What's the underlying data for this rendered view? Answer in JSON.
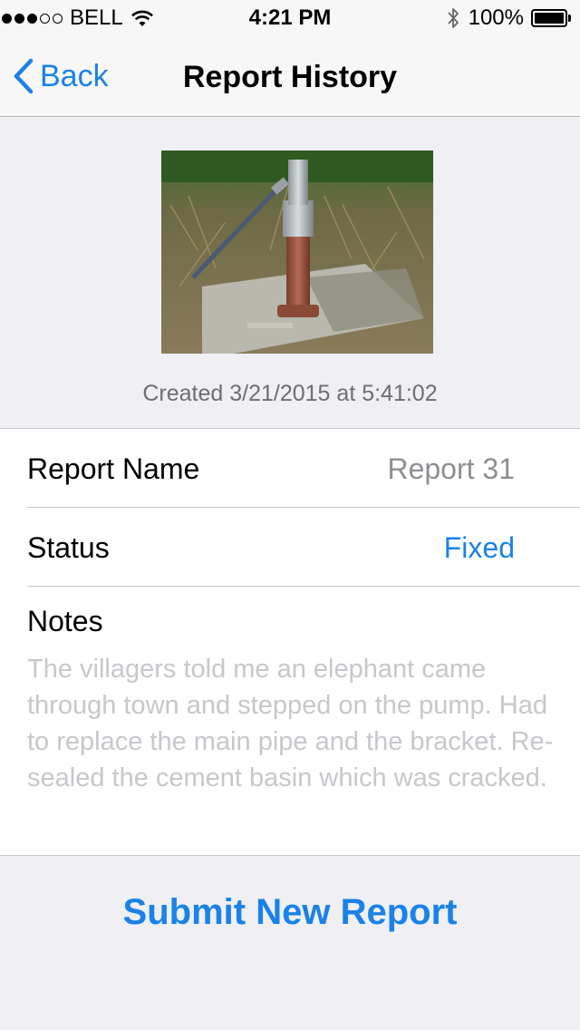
{
  "status_bar": {
    "carrier": "BELL",
    "time": "4:21 PM",
    "battery": "100%",
    "signal_bars": 3,
    "signal_total": 5
  },
  "nav": {
    "back_label": "Back",
    "title": "Report History"
  },
  "report": {
    "created": "Created 3/21/2015 at 5:41:02",
    "name_label": "Report Name",
    "name_value": "Report 31",
    "status_label": "Status",
    "status_value": "Fixed",
    "notes_label": "Notes",
    "notes_text": "The villagers told me an elephant came through town and stepped on the pump. Had to replace the main pipe and the bracket. Re-sealed the cement basin which was cracked."
  },
  "actions": {
    "submit_label": "Submit New Report"
  },
  "colors": {
    "accent": "#1a82e8",
    "background": "#efeff4",
    "placeholder_text": "#c7c7cc"
  }
}
